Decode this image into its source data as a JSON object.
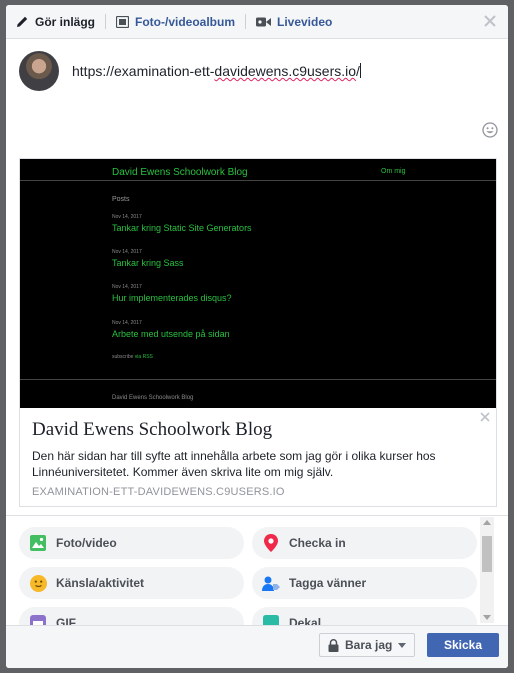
{
  "tabs": [
    {
      "label": "Gör inlägg",
      "icon": "pencil-icon"
    },
    {
      "label": "Foto-/videoalbum",
      "icon": "photo-album-icon"
    },
    {
      "label": "Livevideo",
      "icon": "video-camera-icon"
    }
  ],
  "composer": {
    "text_prefix": "https://examination-ett-",
    "text_underlined": "davidewens.c9users.io",
    "text_suffix": "/"
  },
  "preview": {
    "screenshot": {
      "site_title": "David Ewens Schoolwork Blog",
      "nav_link": "Om mig",
      "posts_heading": "Posts",
      "posts": [
        {
          "date": "Nov 14, 2017",
          "title": "Tankar kring Static Site Generators"
        },
        {
          "date": "Nov 14, 2017",
          "title": "Tankar kring Sass"
        },
        {
          "date": "Nov 14, 2017",
          "title": "Hur implementerades disqus?"
        },
        {
          "date": "Nov 14, 2017",
          "title": "Arbete med utsende på sidan"
        }
      ],
      "subscribe_prefix": "subscribe ",
      "subscribe_link": "via RSS",
      "footer": "David Ewens Schoolwork Blog"
    },
    "title": "David Ewens Schoolwork Blog",
    "description": "Den här sidan har till syfte att innehålla arbete som jag gör i olika kurser hos Linnéuniversitetet. Kommer även skriva lite om mig själv.",
    "domain": "EXAMINATION-ETT-DAVIDEWENS.C9USERS.IO"
  },
  "actions": [
    {
      "label": "Foto/video",
      "icon": "photo-icon",
      "color": "#45bd62"
    },
    {
      "label": "Checka in",
      "icon": "location-pin-icon",
      "color": "#f02849"
    },
    {
      "label": "Känsla/aktivitet",
      "icon": "smiley-icon",
      "color": "#f7b928"
    },
    {
      "label": "Tagga vänner",
      "icon": "tag-friends-icon",
      "color": "#1877f2"
    },
    {
      "label": "GIF",
      "icon": "gif-icon",
      "color": "#8c72cb"
    },
    {
      "label": "Dekal",
      "icon": "sticker-icon",
      "color": "#2abba7"
    }
  ],
  "footer": {
    "audience_label": "Bara jag",
    "share_label": "Skicka"
  },
  "colors": {
    "accent": "#4267b2",
    "link": "#365899",
    "blog_green": "#29c040"
  }
}
